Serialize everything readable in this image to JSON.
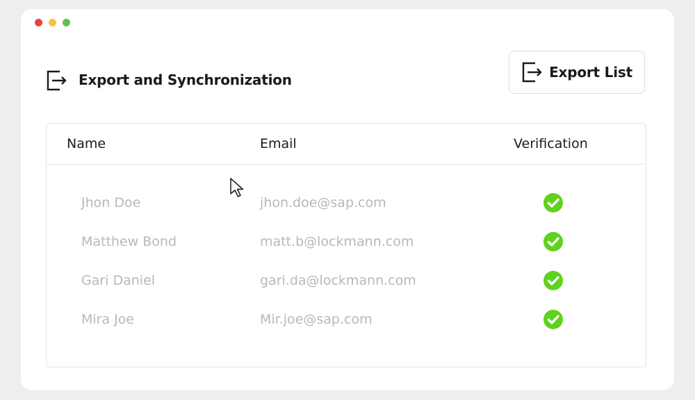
{
  "window": {
    "traffic_lights": [
      {
        "name": "close",
        "color": "#e94040"
      },
      {
        "name": "minimize",
        "color": "#f5c242"
      },
      {
        "name": "maximize",
        "color": "#5cc152"
      }
    ]
  },
  "header": {
    "title": "Export and Synchronization",
    "icon": "export-icon"
  },
  "toolbar": {
    "export_label": "Export List",
    "export_icon": "export-icon"
  },
  "table": {
    "columns": [
      "Name",
      "Email",
      "Verification"
    ],
    "rows": [
      {
        "name": "Jhon Doe",
        "email": "jhon.doe@sap.com",
        "verified": true
      },
      {
        "name": "Matthew Bond",
        "email": "matt.b@lockmann.com",
        "verified": true
      },
      {
        "name": "Gari Daniel",
        "email": "gari.da@lockmann.com",
        "verified": true
      },
      {
        "name": "Mira Joe",
        "email": "Mir.joe@sap.com",
        "verified": true
      }
    ]
  },
  "colors": {
    "verified": "#5fd21e",
    "text_primary": "#1a1a1a",
    "text_muted": "#b8b8b8"
  }
}
